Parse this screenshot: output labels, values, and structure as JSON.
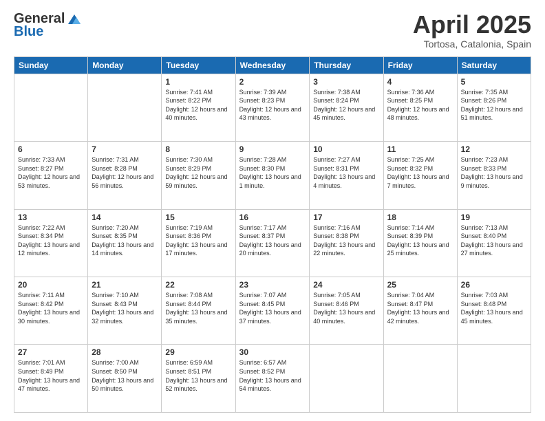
{
  "logo": {
    "general": "General",
    "blue": "Blue"
  },
  "header": {
    "title": "April 2025",
    "subtitle": "Tortosa, Catalonia, Spain"
  },
  "days_of_week": [
    "Sunday",
    "Monday",
    "Tuesday",
    "Wednesday",
    "Thursday",
    "Friday",
    "Saturday"
  ],
  "weeks": [
    [
      {
        "day": "",
        "info": ""
      },
      {
        "day": "",
        "info": ""
      },
      {
        "day": "1",
        "info": "Sunrise: 7:41 AM\nSunset: 8:22 PM\nDaylight: 12 hours and 40 minutes."
      },
      {
        "day": "2",
        "info": "Sunrise: 7:39 AM\nSunset: 8:23 PM\nDaylight: 12 hours and 43 minutes."
      },
      {
        "day": "3",
        "info": "Sunrise: 7:38 AM\nSunset: 8:24 PM\nDaylight: 12 hours and 45 minutes."
      },
      {
        "day": "4",
        "info": "Sunrise: 7:36 AM\nSunset: 8:25 PM\nDaylight: 12 hours and 48 minutes."
      },
      {
        "day": "5",
        "info": "Sunrise: 7:35 AM\nSunset: 8:26 PM\nDaylight: 12 hours and 51 minutes."
      }
    ],
    [
      {
        "day": "6",
        "info": "Sunrise: 7:33 AM\nSunset: 8:27 PM\nDaylight: 12 hours and 53 minutes."
      },
      {
        "day": "7",
        "info": "Sunrise: 7:31 AM\nSunset: 8:28 PM\nDaylight: 12 hours and 56 minutes."
      },
      {
        "day": "8",
        "info": "Sunrise: 7:30 AM\nSunset: 8:29 PM\nDaylight: 12 hours and 59 minutes."
      },
      {
        "day": "9",
        "info": "Sunrise: 7:28 AM\nSunset: 8:30 PM\nDaylight: 13 hours and 1 minute."
      },
      {
        "day": "10",
        "info": "Sunrise: 7:27 AM\nSunset: 8:31 PM\nDaylight: 13 hours and 4 minutes."
      },
      {
        "day": "11",
        "info": "Sunrise: 7:25 AM\nSunset: 8:32 PM\nDaylight: 13 hours and 7 minutes."
      },
      {
        "day": "12",
        "info": "Sunrise: 7:23 AM\nSunset: 8:33 PM\nDaylight: 13 hours and 9 minutes."
      }
    ],
    [
      {
        "day": "13",
        "info": "Sunrise: 7:22 AM\nSunset: 8:34 PM\nDaylight: 13 hours and 12 minutes."
      },
      {
        "day": "14",
        "info": "Sunrise: 7:20 AM\nSunset: 8:35 PM\nDaylight: 13 hours and 14 minutes."
      },
      {
        "day": "15",
        "info": "Sunrise: 7:19 AM\nSunset: 8:36 PM\nDaylight: 13 hours and 17 minutes."
      },
      {
        "day": "16",
        "info": "Sunrise: 7:17 AM\nSunset: 8:37 PM\nDaylight: 13 hours and 20 minutes."
      },
      {
        "day": "17",
        "info": "Sunrise: 7:16 AM\nSunset: 8:38 PM\nDaylight: 13 hours and 22 minutes."
      },
      {
        "day": "18",
        "info": "Sunrise: 7:14 AM\nSunset: 8:39 PM\nDaylight: 13 hours and 25 minutes."
      },
      {
        "day": "19",
        "info": "Sunrise: 7:13 AM\nSunset: 8:40 PM\nDaylight: 13 hours and 27 minutes."
      }
    ],
    [
      {
        "day": "20",
        "info": "Sunrise: 7:11 AM\nSunset: 8:42 PM\nDaylight: 13 hours and 30 minutes."
      },
      {
        "day": "21",
        "info": "Sunrise: 7:10 AM\nSunset: 8:43 PM\nDaylight: 13 hours and 32 minutes."
      },
      {
        "day": "22",
        "info": "Sunrise: 7:08 AM\nSunset: 8:44 PM\nDaylight: 13 hours and 35 minutes."
      },
      {
        "day": "23",
        "info": "Sunrise: 7:07 AM\nSunset: 8:45 PM\nDaylight: 13 hours and 37 minutes."
      },
      {
        "day": "24",
        "info": "Sunrise: 7:05 AM\nSunset: 8:46 PM\nDaylight: 13 hours and 40 minutes."
      },
      {
        "day": "25",
        "info": "Sunrise: 7:04 AM\nSunset: 8:47 PM\nDaylight: 13 hours and 42 minutes."
      },
      {
        "day": "26",
        "info": "Sunrise: 7:03 AM\nSunset: 8:48 PM\nDaylight: 13 hours and 45 minutes."
      }
    ],
    [
      {
        "day": "27",
        "info": "Sunrise: 7:01 AM\nSunset: 8:49 PM\nDaylight: 13 hours and 47 minutes."
      },
      {
        "day": "28",
        "info": "Sunrise: 7:00 AM\nSunset: 8:50 PM\nDaylight: 13 hours and 50 minutes."
      },
      {
        "day": "29",
        "info": "Sunrise: 6:59 AM\nSunset: 8:51 PM\nDaylight: 13 hours and 52 minutes."
      },
      {
        "day": "30",
        "info": "Sunrise: 6:57 AM\nSunset: 8:52 PM\nDaylight: 13 hours and 54 minutes."
      },
      {
        "day": "",
        "info": ""
      },
      {
        "day": "",
        "info": ""
      },
      {
        "day": "",
        "info": ""
      }
    ]
  ]
}
